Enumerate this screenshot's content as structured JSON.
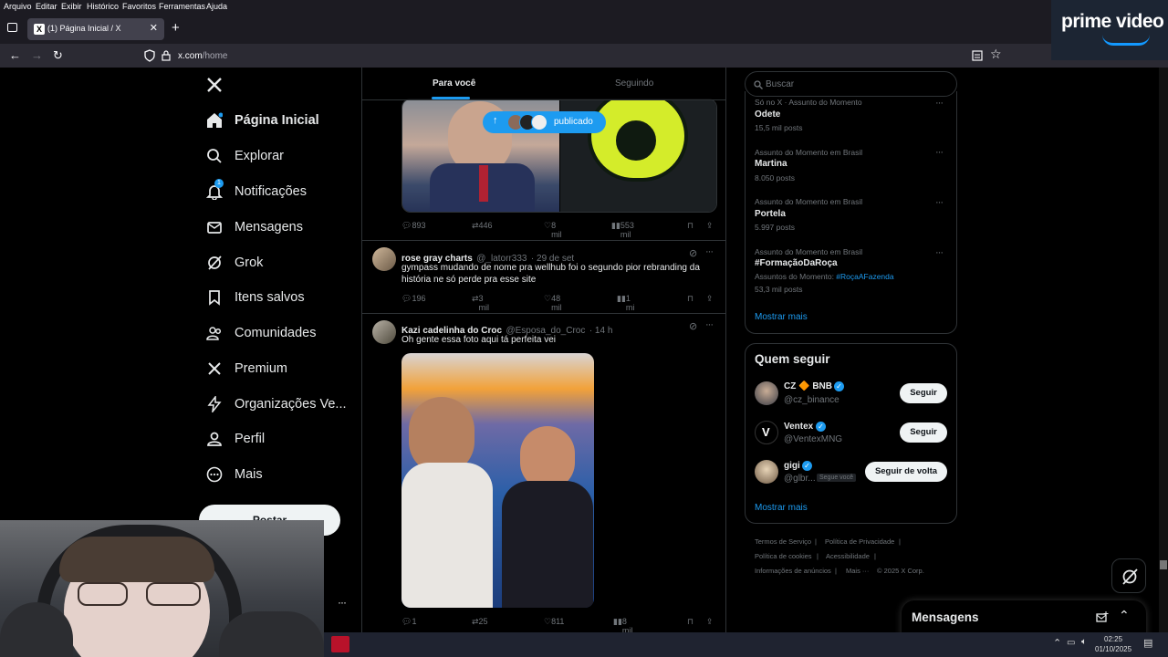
{
  "browser": {
    "menu": [
      "Arquivo",
      "Editar",
      "Exibir",
      "Histórico",
      "Favoritos",
      "Ferramentas",
      "Ajuda"
    ],
    "tab_title": "(1) Página Inicial / X",
    "url_domain": "x.com",
    "url_path": "/home"
  },
  "overlay": {
    "prime_text": "prime video"
  },
  "nav": {
    "items": [
      {
        "label": "Página Inicial",
        "icon": "home-icon"
      },
      {
        "label": "Explorar",
        "icon": "search-icon"
      },
      {
        "label": "Notificações",
        "icon": "bell-icon",
        "badge": "1"
      },
      {
        "label": "Mensagens",
        "icon": "mail-icon"
      },
      {
        "label": "Grok",
        "icon": "grok-icon"
      },
      {
        "label": "Itens salvos",
        "icon": "bookmark-icon"
      },
      {
        "label": "Comunidades",
        "icon": "people-icon"
      },
      {
        "label": "Premium",
        "icon": "x-logo-icon"
      },
      {
        "label": "Organizações Ve...",
        "icon": "lightning-icon"
      },
      {
        "label": "Perfil",
        "icon": "person-icon"
      },
      {
        "label": "Mais",
        "icon": "more-circle-icon"
      }
    ],
    "post_button": "Postar"
  },
  "feed": {
    "tabs": [
      "Para você",
      "Seguindo"
    ],
    "new_posts_pill": "publicado",
    "tweets": [
      {
        "replies": "893",
        "retweets": "446",
        "likes": "8 mil",
        "views": "553 mil"
      },
      {
        "name": "rose gray charts",
        "handle": "@_latorr333",
        "time": "· 29 de set",
        "text": "gympass mudando de nome pra wellhub foi o segundo pior rebranding da história ne  só perde pra esse site",
        "replies": "196",
        "retweets": "3 mil",
        "likes": "48 mil",
        "views": "1 mi"
      },
      {
        "name": "Kazi cadelinha do Croc",
        "handle": "@Esposa_do_Croc",
        "time": "· 14 h",
        "text": "Oh gente essa foto aqui tá perfeita vei",
        "replies": "1",
        "retweets": "25",
        "likes": "811",
        "views": "8 mil"
      }
    ]
  },
  "right": {
    "search_placeholder": "Buscar",
    "trends": [
      {
        "context": "Só no X · Assunto do Momento",
        "name": "Odete",
        "count": "15,5 mil posts"
      },
      {
        "context": "Assunto do Momento em Brasil",
        "name": "Martina",
        "count": "8.050 posts"
      },
      {
        "context": "Assunto do Momento em Brasil",
        "name": "Portela",
        "count": "5.997 posts"
      },
      {
        "context": "Assunto do Momento em Brasil",
        "name": "#FormaçãoDaRoça",
        "extra_prefix": "Assuntos do Momento: ",
        "extra_tag": "#RoçaAFazenda",
        "count": "53,3 mil posts"
      }
    ],
    "show_more": "Mostrar mais",
    "who_to_follow_title": "Quem seguir",
    "follow": [
      {
        "name": "CZ 🔶 BNB",
        "handle": "@cz_binance",
        "button": "Seguir"
      },
      {
        "name": "Ventex",
        "handle": "@VentexMNG",
        "button": "Seguir"
      },
      {
        "name": "gigi",
        "handle": "@glbr...",
        "follows_you": "Segue você",
        "button": "Seguir de volta"
      }
    ],
    "footer": [
      "Termos de Serviço",
      "Política de Privacidade",
      "Política de cookies",
      "Acessibilidade",
      "Informações de anúncios",
      "Mais ···",
      "© 2025 X Corp."
    ],
    "messages_title": "Mensagens"
  },
  "taskbar": {
    "time": "02:25",
    "date": "01/10/2025"
  },
  "colors": {
    "accent": "#1d9bf0",
    "background": "#000000",
    "border": "#2f3336",
    "muted": "#71767b"
  }
}
